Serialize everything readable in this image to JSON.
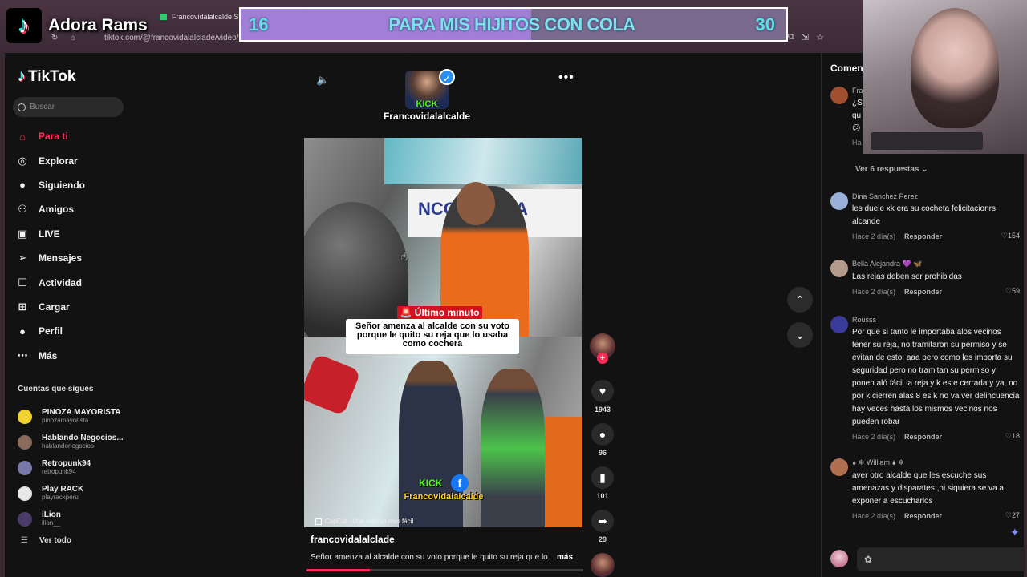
{
  "browser": {
    "tab_title": "Francovidalalcalde Stream",
    "url": "tiktok.com/@francovidalalclade/video/7"
  },
  "overlay": {
    "streamer_name": "Adora Rams",
    "goal": {
      "current": "16",
      "title": "PARA MIS HIJITOS CON COLA",
      "target": "30",
      "progress": 0.533
    }
  },
  "sidebar": {
    "logo": "TikTok",
    "search_placeholder": "Buscar",
    "nav": [
      {
        "label": "Para ti",
        "icon": "home-icon",
        "glyph": "⌂"
      },
      {
        "label": "Explorar",
        "icon": "compass-icon",
        "glyph": "◎"
      },
      {
        "label": "Siguiendo",
        "icon": "following-avatar-icon",
        "glyph": "●"
      },
      {
        "label": "Amigos",
        "icon": "friends-icon",
        "glyph": "⚇"
      },
      {
        "label": "LIVE",
        "icon": "live-icon",
        "glyph": "▣"
      },
      {
        "label": "Mensajes",
        "icon": "send-icon",
        "glyph": "➢"
      },
      {
        "label": "Actividad",
        "icon": "inbox-icon",
        "glyph": "☐"
      },
      {
        "label": "Cargar",
        "icon": "upload-icon",
        "glyph": "⊞"
      },
      {
        "label": "Perfil",
        "icon": "profile-icon",
        "glyph": "●"
      },
      {
        "label": "Más",
        "icon": "more-icon",
        "glyph": "⋯"
      }
    ],
    "following_title": "Cuentas que sigues",
    "following": [
      {
        "name": "PINOZA MAYORISTA",
        "handle": "pinozamayorista",
        "color": "#f2d22e"
      },
      {
        "name": "Hablando Negocios...",
        "handle": "hablandonegocios",
        "color": "#8a6a5a"
      },
      {
        "name": "Retropunk94",
        "handle": "retropunk94",
        "color": "#7a7aa8"
      },
      {
        "name": "Play RACK",
        "handle": "playrackperu",
        "color": "#e8e8e8"
      },
      {
        "name": "iLion",
        "handle": "ilion__",
        "color": "#4b3a6a"
      }
    ],
    "see_all": "Ver todo"
  },
  "video": {
    "stamp_kick": "KICK",
    "stamp_handle": "Francovidalalcalde",
    "banner_text": "NCO VIDALA",
    "breaking": "🚨 Último minuto 🚨",
    "caption": "Señor amenza al alcalde  con su voto porque le quito su reja que lo usaba como cochera",
    "kick": "KICK",
    "fb": "f",
    "kick_handle": "Francovidalalcalde",
    "capcut": "CapCut - Una edición más fácil",
    "author": "francovidalalclade",
    "description": "Señor amenza al alcalde  con su voto porque le quito su reja que lo",
    "more": "más",
    "progress": 0.23,
    "actions": [
      {
        "icon": "heart-icon",
        "glyph": "♥",
        "count": "1943"
      },
      {
        "icon": "comment-icon",
        "glyph": "●",
        "count": "96"
      },
      {
        "icon": "bookmark-icon",
        "glyph": "▮",
        "count": "101"
      },
      {
        "icon": "share-icon",
        "glyph": "➦",
        "count": "29"
      }
    ]
  },
  "comments": {
    "title": "Comentarios",
    "first_user": "Fra",
    "first_lines": "¿S\nqu\n😕",
    "first_meta": "Ha",
    "view_replies": "Ver 6 respuestas ⌄",
    "items": [
      {
        "user": "Dina Sanchez Perez",
        "text": "les duele xk era su cocheta felicitacionrs alcande",
        "time": "Hace 2 día(s)",
        "reply": "Responder",
        "likes": "♡154",
        "color": "#9bb0d8"
      },
      {
        "user": "Bella Alejandra 💜 🦋",
        "text": "Las rejas deben ser prohibidas",
        "time": "Hace 2 día(s)",
        "reply": "Responder",
        "likes": "♡59",
        "color": "#b49a8a"
      },
      {
        "user": "Rousss",
        "text": "Por que si tanto le importaba alos vecinos tener su reja, no tramitaron su permiso y se evitan de esto, aaa pero como les importa su seguridad pero no tramitan su permiso y ponen aló fácil la reja y k este cerrada y ya, no por k cierren alas 8 es k no va ver delincuencia hay veces hasta los mismos vecinos nos pueden robar",
        "time": "Hace 2 día(s)",
        "reply": "Responder",
        "likes": "♡18",
        "color": "#3a3a9a"
      },
      {
        "user": "🌢 ❄ William 🌢 ❄",
        "text": "aver otro alcalde que les escuche sus amenazas y disparates ,ni siquiera se va a exponer a escucharlos",
        "time": "Hace 2 día(s)",
        "reply": "Responder",
        "likes": "♡27",
        "color": "#b07050"
      }
    ]
  }
}
